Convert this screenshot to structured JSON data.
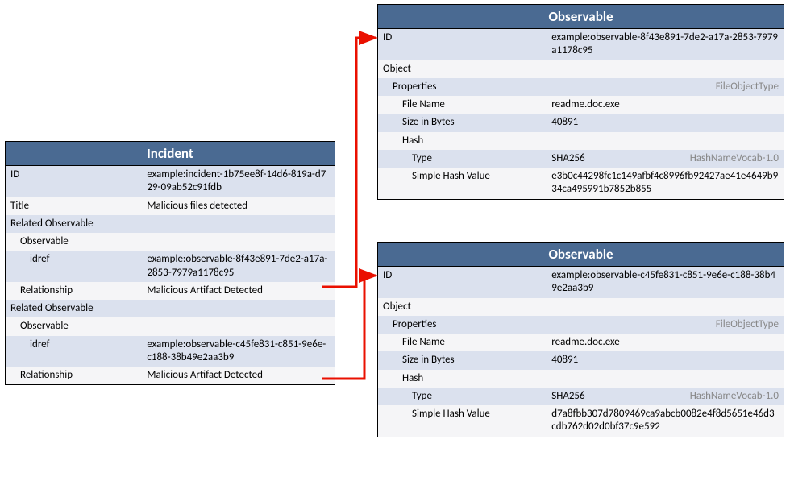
{
  "incident": {
    "title": "Incident",
    "rows": {
      "id_label": "ID",
      "id_value": "example:incident-1b75ee8f-14d6-819a-d729-09ab52c91fdb",
      "title_label": "Title",
      "title_value": "Malicious files detected",
      "rel_obs_a_label": "Related Observable",
      "obs_a_label": "Observable",
      "idref_a_label": "idref",
      "idref_a_value": "example:observable-8f43e891-7de2-a17a-2853-7979a1178c95",
      "rel_a_label": "Relationship",
      "rel_a_value": "Malicious Artifact Detected",
      "rel_obs_b_label": "Related Observable",
      "obs_b_label": "Observable",
      "idref_b_label": "idref",
      "idref_b_value": "example:observable-c45fe831-c851-9e6e-c188-38b49e2aa3b9",
      "rel_b_label": "Relationship",
      "rel_b_value": "Malicious Artifact Detected"
    }
  },
  "observable1": {
    "title": "Observable",
    "id_label": "ID",
    "id_value": "example:observable-8f43e891-7de2-a17a-2853-7979a1178c95",
    "object_label": "Object",
    "props_label": "Properties",
    "props_annot": "FileObjectType",
    "fname_label": "File Name",
    "fname_value": "readme.doc.exe",
    "size_label": "Size in Bytes",
    "size_value": "40891",
    "hash_label": "Hash",
    "type_label": "Type",
    "type_value": "SHA256",
    "type_annot": "HashNameVocab-1.0",
    "shv_label": "Simple Hash Value",
    "shv_value": "e3b0c44298fc1c149afbf4c8996fb92427ae41e4649b934ca495991b7852b855"
  },
  "observable2": {
    "title": "Observable",
    "id_label": "ID",
    "id_value": "example:observable-c45fe831-c851-9e6e-c188-38b49e2aa3b9",
    "object_label": "Object",
    "props_label": "Properties",
    "props_annot": "FileObjectType",
    "fname_label": "File Name",
    "fname_value": "readme.doc.exe",
    "size_label": "Size in Bytes",
    "size_value": "40891",
    "hash_label": "Hash",
    "type_label": "Type",
    "type_value": "SHA256",
    "type_annot": "HashNameVocab-1.0",
    "shv_label": "Simple Hash Value",
    "shv_value": "d7a8fbb307d7809469ca9abcb0082e4f8d5651e46d3cdb762d02d0bf37c9e592"
  }
}
